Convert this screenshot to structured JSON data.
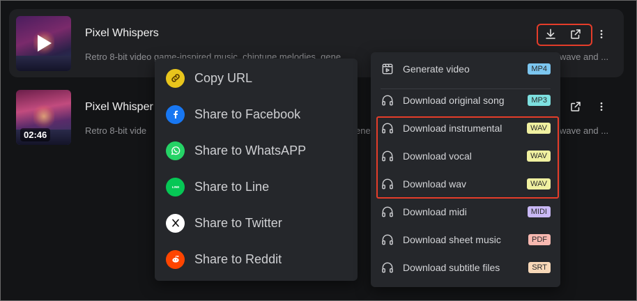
{
  "tracks": [
    {
      "title": "Pixel Whispers",
      "description": "Retro 8-bit video game-inspired music, chiptune melodies, gene",
      "description_tail": "wave and ..."
    },
    {
      "title": "Pixel Whisper",
      "description": "Retro 8-bit vide",
      "description_right": "ene",
      "description_tail": "wave and ...",
      "duration": "02:46"
    }
  ],
  "share_menu": {
    "items": [
      {
        "label": "Copy URL",
        "icon": "link-icon",
        "color": "#e8c51c"
      },
      {
        "label": "Share to Facebook",
        "icon": "facebook-icon",
        "color": "#1877f2"
      },
      {
        "label": "Share to WhatsAPP",
        "icon": "whatsapp-icon",
        "color": "#25d366"
      },
      {
        "label": "Share to Line",
        "icon": "line-icon",
        "color": "#06c755"
      },
      {
        "label": "Share to Twitter",
        "icon": "x-twitter-icon",
        "color": "#ffffff"
      },
      {
        "label": "Share to Reddit",
        "icon": "reddit-icon",
        "color": "#ff4500"
      }
    ]
  },
  "download_menu": {
    "items": [
      {
        "label": "Generate video",
        "tag": "MP4",
        "tag_color": "#7cc6f0",
        "icon": "video-icon"
      },
      {
        "label": "Download original song",
        "tag": "MP3",
        "tag_color": "#7de0e0",
        "icon": "headphones-icon"
      },
      {
        "label": "Download instrumental",
        "tag": "WAV",
        "tag_color": "#f0f0a0",
        "icon": "headphones-icon"
      },
      {
        "label": "Download vocal",
        "tag": "WAV",
        "tag_color": "#f0f0a0",
        "icon": "headphones-icon"
      },
      {
        "label": "Download wav",
        "tag": "WAV",
        "tag_color": "#f0f0a0",
        "icon": "headphones-icon"
      },
      {
        "label": "Download midi",
        "tag": "MIDI",
        "tag_color": "#c9b8f5",
        "icon": "headphones-icon"
      },
      {
        "label": "Download sheet music",
        "tag": "PDF",
        "tag_color": "#f7b8b0",
        "icon": "headphones-icon"
      },
      {
        "label": "Download subtitle files",
        "tag": "SRT",
        "tag_color": "#f7d8b8",
        "icon": "headphones-icon"
      }
    ]
  },
  "colors": {
    "background": "#131416",
    "highlight": "#e53d2a",
    "menu": "#25272b"
  }
}
